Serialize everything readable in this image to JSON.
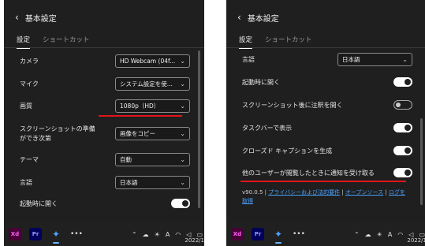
{
  "left": {
    "header": {
      "back_icon": "chevron-left-icon",
      "title": "基本設定"
    },
    "tabs": [
      {
        "label": "設定"
      },
      {
        "label": "ショートカット"
      }
    ],
    "rows": [
      {
        "label": "カメラ",
        "value": "HD Webcam (04f..."
      },
      {
        "label": "マイク",
        "value": "システム設定を使..."
      },
      {
        "label": "画質",
        "value": "1080p（HD）"
      },
      {
        "label": "スクリーンショットの準備ができ次第",
        "value": "画像をコピー"
      },
      {
        "label": "テーマ",
        "value": "自動"
      },
      {
        "label": "言語",
        "value": "日本語"
      }
    ],
    "toggle_row": {
      "label": "起動時に開く",
      "state": "on"
    }
  },
  "right": {
    "header": {
      "back_icon": "chevron-left-icon",
      "title": "基本設定"
    },
    "tabs": [
      {
        "label": "設定"
      },
      {
        "label": "ショートカット"
      }
    ],
    "language": {
      "label": "言語",
      "value": "日本語"
    },
    "toggles": [
      {
        "label": "起動時に開く",
        "state": "on"
      },
      {
        "label": "スクリーンショット後に注釈を開く",
        "state": "off"
      },
      {
        "label": "タスクバーで表示",
        "state": "on"
      },
      {
        "label": "クローズド キャプションを生成",
        "state": "on"
      },
      {
        "label": "他のユーザーが閲覧したときに通知を受け取る",
        "state": "on"
      }
    ],
    "footer": {
      "version": "v90.0.5 |",
      "privacy_link": "プライバシーおよび法的要件",
      "sep1": "|",
      "oss_link": "オープンソース",
      "sep2": "|",
      "log_link": "ログを",
      "log_link_2": "取得"
    }
  },
  "taskbar": {
    "apps": [
      {
        "label": "Xd"
      },
      {
        "label": "Pr"
      }
    ],
    "more": "•••",
    "tray_letter": "A",
    "clock_left": "2022/1",
    "clock_right": "2022/1"
  },
  "colors": {
    "panel": "#1f1f1f",
    "accent_red": "#e0151b",
    "link": "#4aa3ff"
  }
}
